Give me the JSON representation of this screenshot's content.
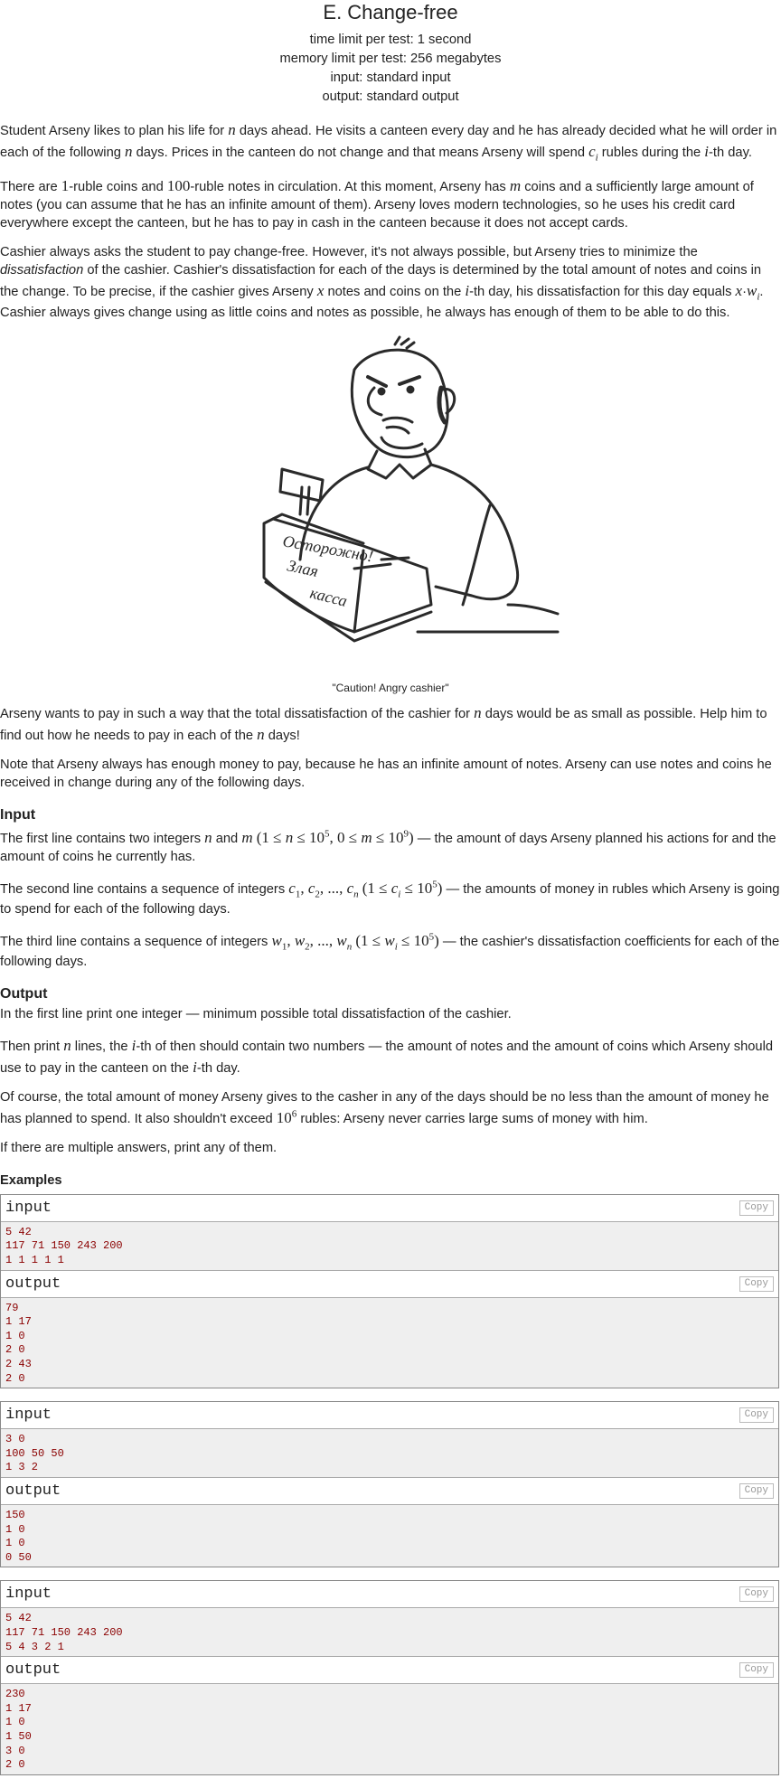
{
  "header": {
    "title": "E. Change-free",
    "time_limit": "time limit per test: 1 second",
    "memory_limit": "memory limit per test: 256 megabytes",
    "input": "input: standard input",
    "output": "output: standard output"
  },
  "figure": {
    "caption": "\"Caution! Angry cashier\"",
    "sign_text": [
      "Осторожно!",
      "Злая",
      "касса"
    ]
  },
  "examples_title": "Examples",
  "input_title": "Input",
  "output_title": "Output",
  "copy_label": "Copy",
  "input_label": "input",
  "output_label": "output",
  "examples": [
    {
      "input": [
        "5 42",
        "117 71 150 243 200",
        "1 1 1 1 1"
      ],
      "output": [
        "79",
        "1 17",
        "1 0",
        "2 0",
        "2 43",
        "2 0"
      ]
    },
    {
      "input": [
        "3 0",
        "100 50 50",
        "1 3 2"
      ],
      "output": [
        "150",
        "1 0",
        "1 0",
        "0 50"
      ]
    },
    {
      "input": [
        "5 42",
        "117 71 150 243 200",
        "5 4 3 2 1"
      ],
      "output": [
        "230",
        "1 17",
        "1 0",
        "1 50",
        "3 0",
        "2 0"
      ]
    }
  ]
}
